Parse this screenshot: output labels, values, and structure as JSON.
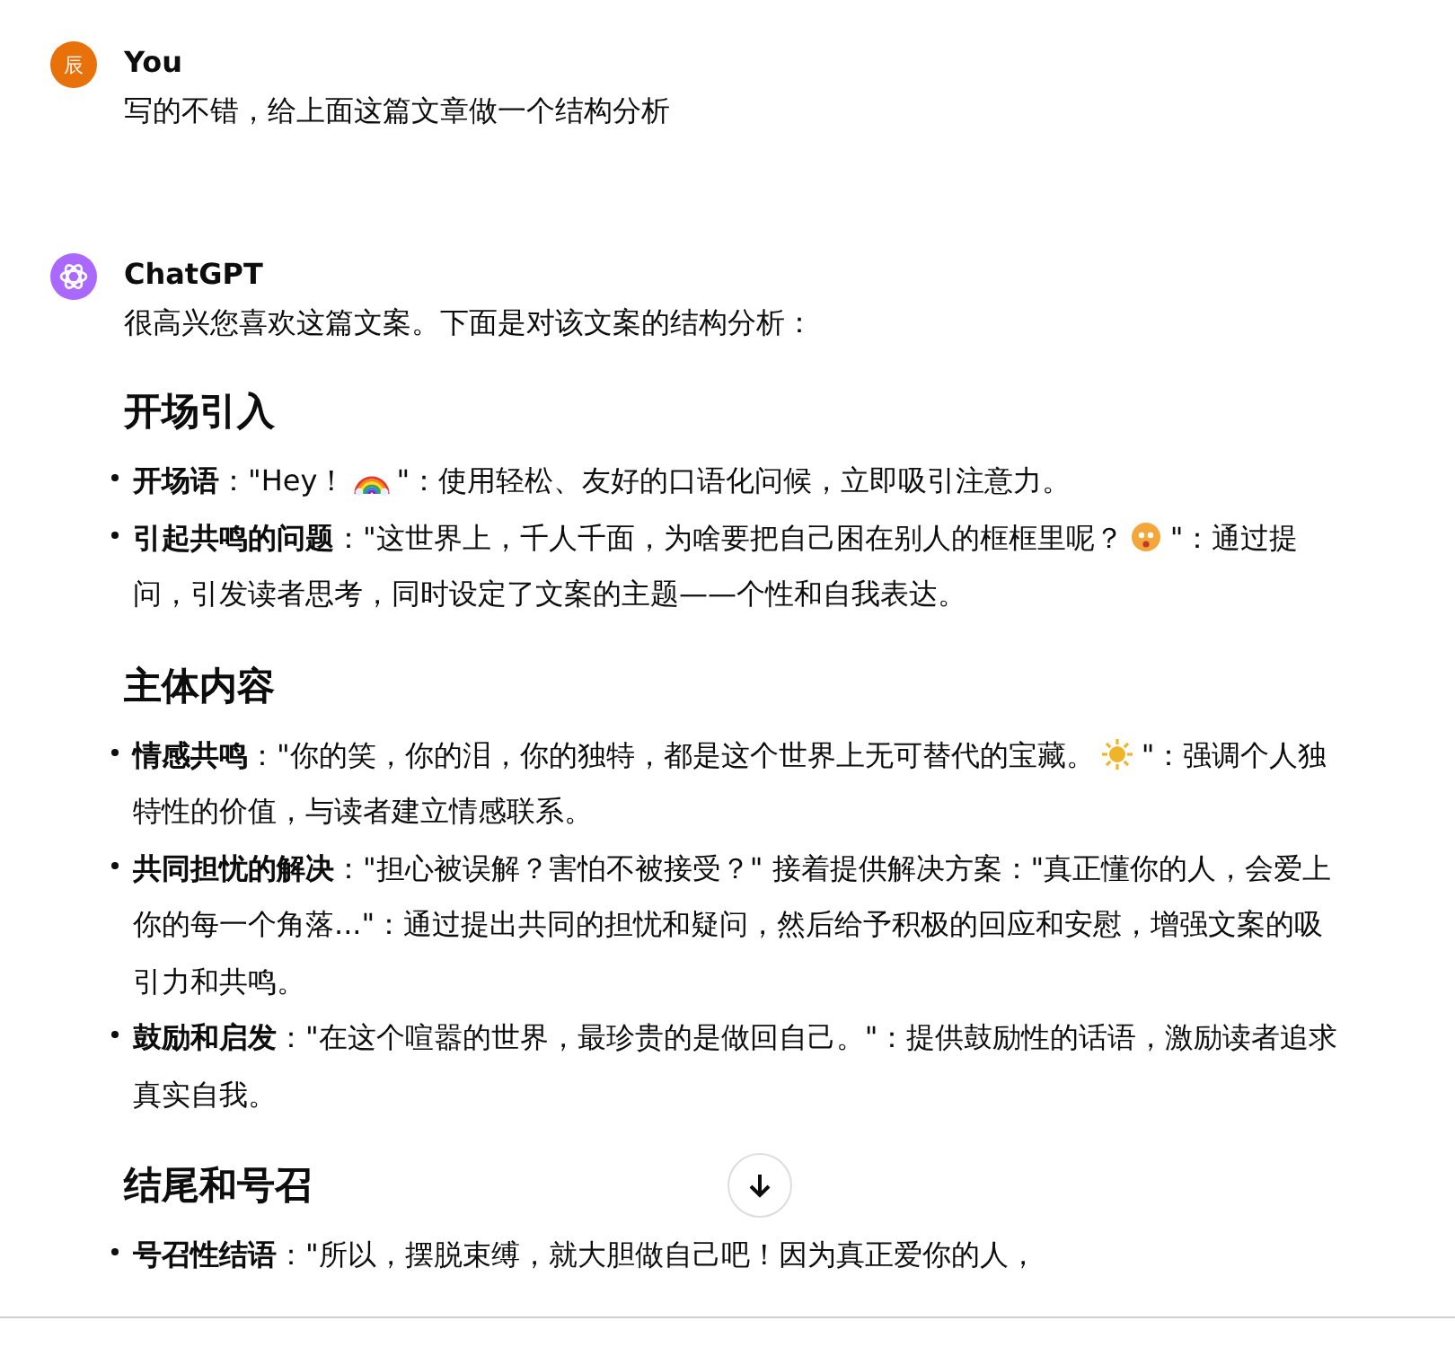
{
  "messages": [
    {
      "author": "You",
      "avatar": "辰",
      "kind": "user",
      "text": "写的不错，给上面这篇文章做一个结构分析"
    },
    {
      "author": "ChatGPT",
      "kind": "assistant",
      "text": "很高兴您喜欢这篇文案。下面是对该文案的结构分析：",
      "sections": [
        {
          "heading": "开场引入",
          "items": [
            {
              "term": "开场语",
              "body": [
                {
                  "kind": "text",
                  "text": "：\"Hey！"
                },
                {
                  "kind": "rainbow"
                },
                {
                  "kind": "text",
                  "text": "\"：使用轻松、友好的口语化问候，立即吸引注意力。"
                }
              ]
            },
            {
              "term": "引起共鸣的问题",
              "body": [
                {
                  "kind": "text",
                  "text": "：\"这世界上，千人千面，为啥要把自己困在别人的框框里呢？"
                },
                {
                  "kind": "face"
                },
                {
                  "kind": "text",
                  "text": "\"：通过提问，引发读者思考，同时设定了文案的主题——个性和自我表达。"
                }
              ]
            }
          ]
        },
        {
          "heading": "主体内容",
          "items": [
            {
              "term": "情感共鸣",
              "body": [
                {
                  "kind": "text",
                  "text": "：\"你的笑，你的泪，你的独特，都是这个世界上无可替代的宝藏。"
                },
                {
                  "kind": "sun"
                },
                {
                  "kind": "text",
                  "text": "\"：强调个人独特性的价值，与读者建立情感联系。"
                }
              ]
            },
            {
              "term": "共同担忧的解决",
              "body": [
                {
                  "kind": "text",
                  "text": "：\"担心被误解？害怕不被接受？\" 接着提供解决方案：\"真正懂你的人，会爱上你的每一个角落...\"：通过提出共同的担忧和疑问，然后给予积极的回应和安慰，增强文案的吸引力和共鸣。"
                }
              ]
            },
            {
              "term": "鼓励和启发",
              "body": [
                {
                  "kind": "text",
                  "text": "：\"在这个喧嚣的世界，最珍贵的是做回自己。\"：提供鼓励性的话语，激励读者追求真实自我。"
                }
              ]
            }
          ]
        },
        {
          "heading": "结尾和号召",
          "items": [
            {
              "term": "号召性结语",
              "body": [
                {
                  "kind": "text",
                  "text": "：\"所以，摆脱束缚，就大胆做自己吧！因为真正爱你的人，"
                }
              ]
            }
          ]
        }
      ]
    }
  ]
}
